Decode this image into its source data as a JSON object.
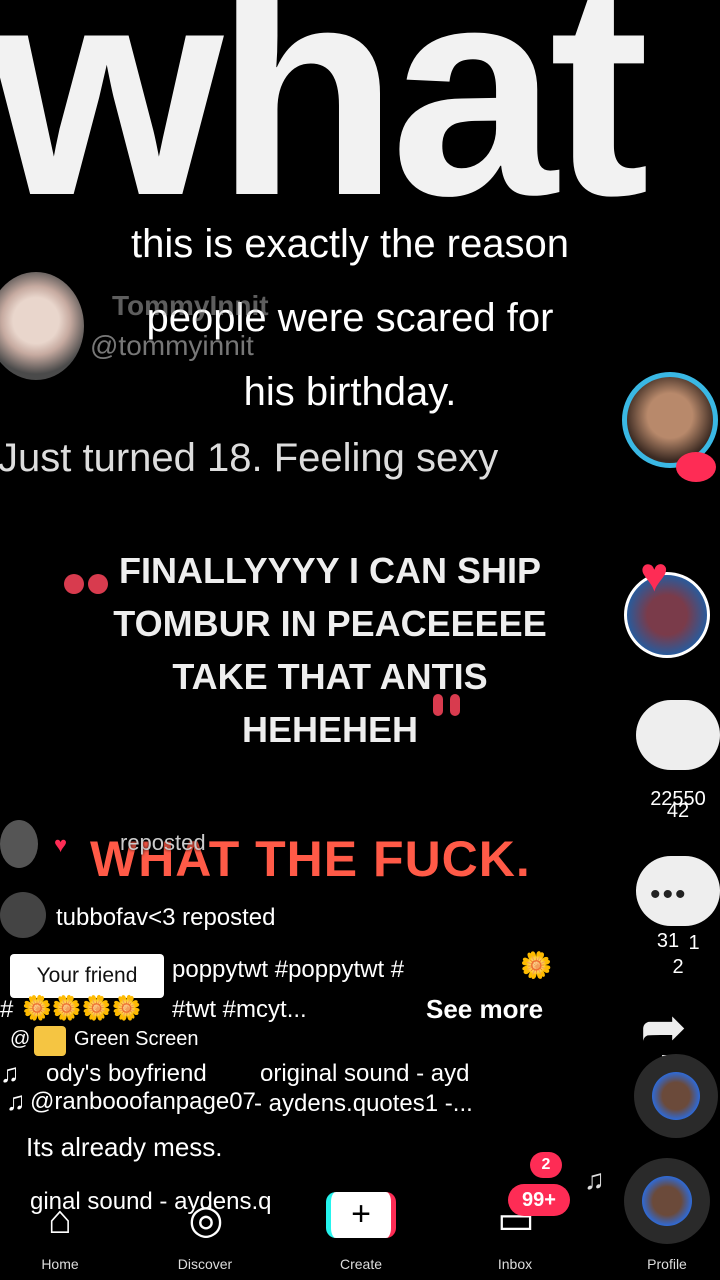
{
  "background_word": "what",
  "caption": {
    "line1": "this is exactly the reason",
    "line2": "people were scared for",
    "line3": "his birthday."
  },
  "tweet": {
    "name": "TommyInnit",
    "handle": "@tommyinnit",
    "body": "Just turned 18. Feeling sexy"
  },
  "quote": {
    "line1": "FINALLYYYY I CAN SHIP",
    "line2": "TOMBUR IN PEACEEEEE",
    "line3": "TAKE THAT ANTIS",
    "line4": "HEHEHEH"
  },
  "reaction": "WHAT THE FUCK.",
  "reposted_small": "reposted",
  "repost_row": "tubbofav<3 reposted",
  "friend_tag": "Your friend",
  "hashtags_line1": "poppytwt #poppytwt  #",
  "hashtags_line2": "#twt #mcyt...",
  "see_more": "See more",
  "green_screen": "Green Screen",
  "music_line1_left": "ody's boyfriend",
  "music_line1_right": "original sound - ayd",
  "music_line2_user": "@ranbooofanpage07",
  "music_line2_sound": "- aydens.quotes1 -...",
  "comment": "Its already mess.",
  "bottom_sound": "ginal sound - aydens.q",
  "counts": {
    "likes_a": "22550",
    "likes_b": "42",
    "comments_a": "31",
    "comments_b": "1",
    "comments_c": "2",
    "shares": "5"
  },
  "nav": {
    "home": "Home",
    "discover": "Discover",
    "create": "Create",
    "inbox": "Inbox",
    "profile": "Profile",
    "inbox_badge": "99+",
    "top_badge": "2"
  },
  "colors": {
    "accent_red": "#fe2c55",
    "quote_red": "#d83b4e",
    "reaction_orange": "#ff5a47"
  }
}
